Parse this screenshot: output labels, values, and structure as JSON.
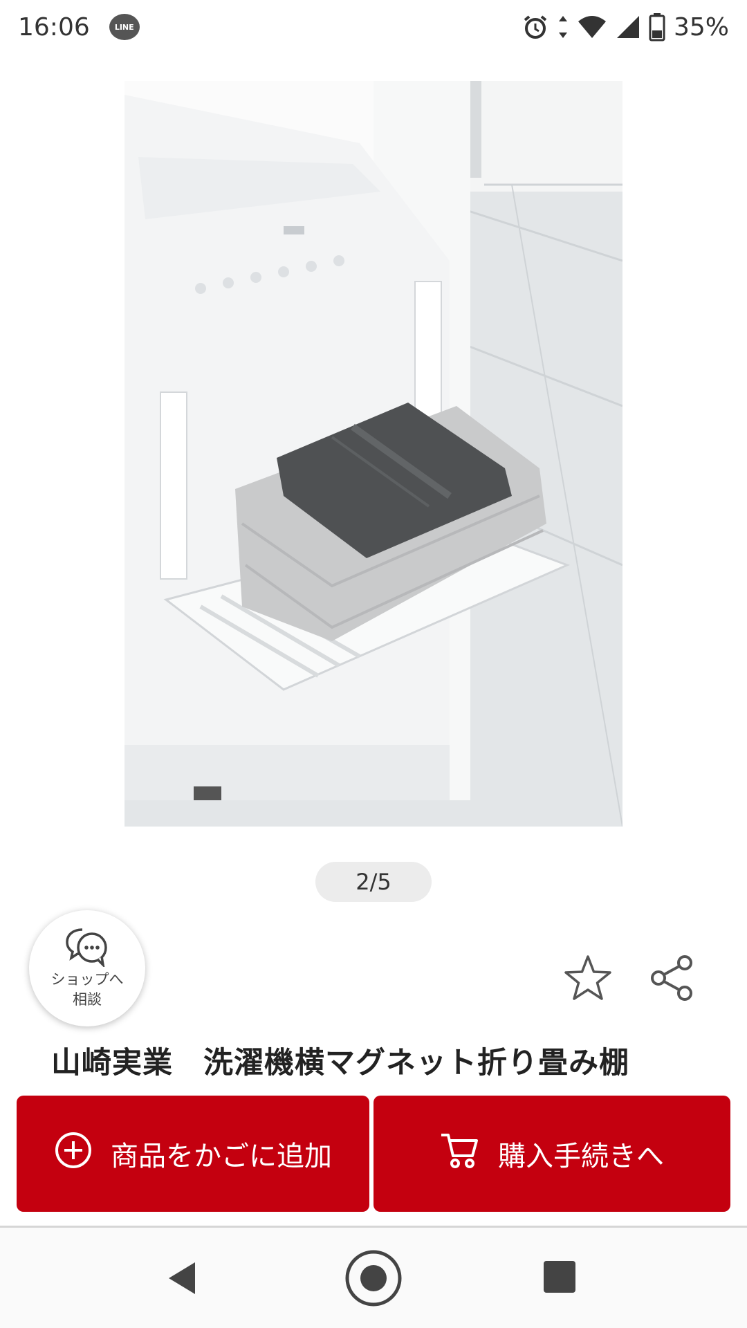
{
  "status_bar": {
    "time": "16:06",
    "notification_app": "LINE",
    "battery_percent": "35%",
    "icons": [
      "line-icon",
      "alarm-icon",
      "data-arrows-icon",
      "wifi-icon",
      "signal-icon",
      "battery-icon"
    ]
  },
  "product": {
    "image_counter": "2/5",
    "title": "山崎実業　洗濯機横マグネット折り畳み棚"
  },
  "chat": {
    "label_line1": "ショップへ",
    "label_line2": "相談"
  },
  "actions": {
    "add_to_cart": "商品をかごに追加",
    "checkout": "購入手続きへ"
  },
  "colors": {
    "accent": "#c4000f",
    "pager_bg": "#ececec"
  }
}
